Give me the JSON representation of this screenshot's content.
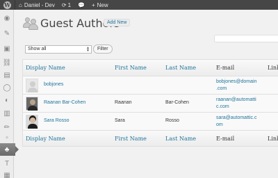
{
  "admin_bar": {
    "site_name": "Daniel - Dev",
    "updates_count": "1",
    "new_label": "New"
  },
  "page": {
    "title": "Guest Authors",
    "add_new_label": "Add New"
  },
  "filter": {
    "selected": "Show all",
    "button_label": "Filter"
  },
  "table": {
    "columns": [
      "Display Name",
      "First Name",
      "Last Name",
      "E-mail",
      "Link"
    ],
    "rows": [
      {
        "display_name": "bobjones",
        "first_name": "",
        "last_name": "",
        "email_line1": "bobjones@domain",
        "email_line2": ".com"
      },
      {
        "display_name": "Raanan Bar-Cohen",
        "first_name": "Raanan",
        "last_name": "Bar-Cohen",
        "email_line1": "raanan@automatti",
        "email_line2": "c.com"
      },
      {
        "display_name": "Sara Rosso",
        "first_name": "Sara",
        "last_name": "Rosso",
        "email_line1": "sara@automattic.c",
        "email_line2": "om"
      }
    ]
  },
  "colors": {
    "link": "#21759b",
    "admin_bar": "#464646"
  }
}
